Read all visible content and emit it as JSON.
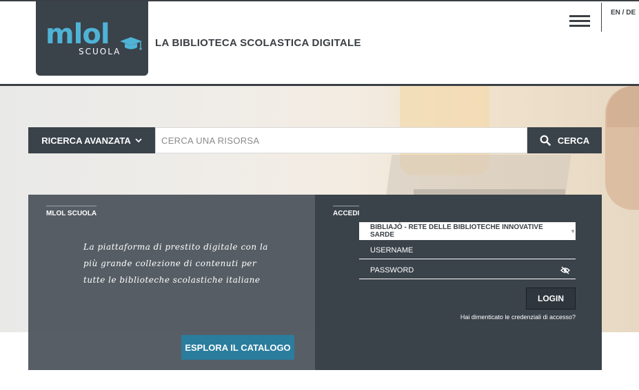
{
  "header": {
    "logo_main": "mlol",
    "logo_sub": "SCUOLA",
    "tagline": "LA BIBLIOTECA SCOLASTICA DIGITALE",
    "lang": "EN / DE"
  },
  "search": {
    "advanced_label": "RICERCA AVANZATA",
    "placeholder": "CERCA UNA RISORSA",
    "button_label": "CERCA"
  },
  "left_panel": {
    "title": "MLOL SCUOLA",
    "description": "La piattaforma di prestito digitale con la più grande collezione di contenuti per tutte le biblioteche scolastiche italiane",
    "explore_label": "ESPLORA IL CATALOGO"
  },
  "login_panel": {
    "title": "ACCEDI",
    "library_selected": "BIBLIAJÒ - RETE DELLE BIBLIOTECHE INNOVATIVE SARDE",
    "username_placeholder": "USERNAME",
    "password_placeholder": "PASSWORD",
    "login_label": "LOGIN",
    "forgot_label": "Hai dimenticato le credenziali di accesso?"
  },
  "colors": {
    "dark": "#3a424a",
    "accent": "#4fb3d6",
    "button_blue": "#2b7d9e"
  }
}
